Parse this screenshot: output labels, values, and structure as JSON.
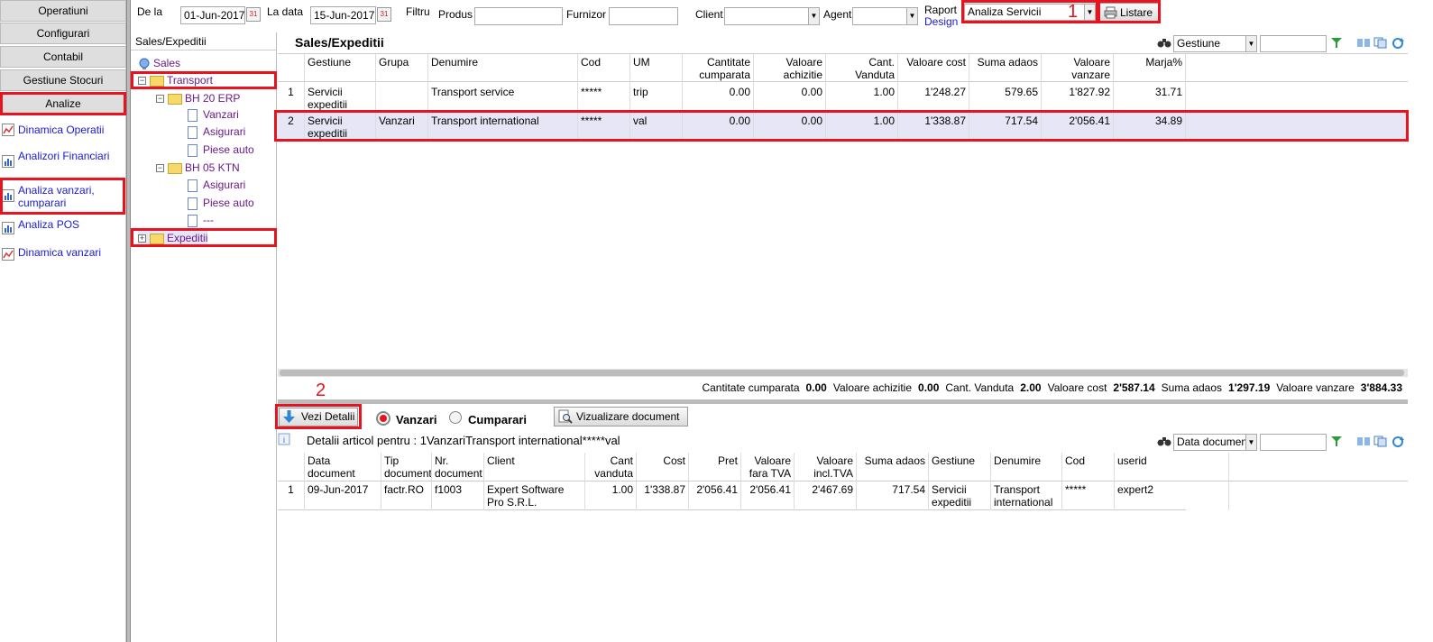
{
  "nav": {
    "buttons": [
      "Operatiuni",
      "Configurari",
      "Contabil",
      "Gestiune Stocuri",
      "Analize"
    ],
    "links": [
      "Dinamica Operatii",
      "Analizori Financiari",
      "Analiza vanzari, cumparari",
      "Analiza POS",
      "Dinamica vanzari"
    ]
  },
  "toolbar": {
    "de_la_label": "De la",
    "de_la_value": "01-Jun-2017",
    "la_data_label": "La data",
    "la_data_value": "15-Jun-2017",
    "filtru_label": "Filtru",
    "produs_label": "Produs",
    "furnizor_label": "Furnizor",
    "client_label": "Client",
    "agent_label": "Agent",
    "raport_label": "Raport",
    "design_link": "Design",
    "raport_value": "Analiza Servicii",
    "listare_label": "Listare",
    "marker1": "1",
    "marker2": "2"
  },
  "tree": {
    "header": "Sales/Expeditii",
    "items": [
      "Sales",
      "Transport",
      "BH 20 ERP",
      "Vanzari",
      "Asigurari",
      "Piese auto",
      "BH 05 KTN",
      "Asigurari",
      "Piese auto",
      "---",
      "Expeditii"
    ]
  },
  "main": {
    "title": "Sales/Expeditii",
    "gestiune_select": "Gestiune",
    "columns": [
      "Gestiune",
      "Grupa",
      "Denumire",
      "Cod",
      "UM",
      "Cantitate cumparata",
      "Valoare achizitie",
      "Cant. Vanduta",
      "Valoare cost",
      "Suma adaos",
      "Valoare vanzare",
      "Marja%"
    ],
    "rows": [
      [
        "1",
        "Servicii expeditii",
        "",
        "Transport service",
        "*****",
        "trip",
        "0.00",
        "0.00",
        "1.00",
        "1'248.27",
        "579.65",
        "1'827.92",
        "31.71"
      ],
      [
        "2",
        "Servicii expeditii",
        "Vanzari",
        "Transport international",
        "*****",
        "val",
        "0.00",
        "0.00",
        "1.00",
        "1'338.87",
        "717.54",
        "2'056.41",
        "34.89"
      ]
    ],
    "totals": [
      {
        "label": "Cantitate cumparata",
        "value": "0.00"
      },
      {
        "label": "Valoare achizitie",
        "value": "0.00"
      },
      {
        "label": "Cant. Vanduta",
        "value": "2.00"
      },
      {
        "label": "Valoare cost",
        "value": "2'587.14"
      },
      {
        "label": "Suma adaos",
        "value": "1'297.19"
      },
      {
        "label": "Valoare vanzare",
        "value": "3'884.33"
      }
    ]
  },
  "details": {
    "vezi_label": "Vezi Detalii",
    "radio_vanzari": "Vanzari",
    "radio_cumparari": "Cumparari",
    "viz_button": "Vizualizare document",
    "title": "Detalii articol pentru : 1VanzariTransport international*****val",
    "sort_select": "Data documen",
    "columns": [
      "Data document",
      "Tip document",
      "Nr. document",
      "Client",
      "Cant vanduta",
      "Cost",
      "Pret",
      "Valoare fara TVA",
      "Valoare incl.TVA",
      "Suma adaos",
      "Gestiune",
      "Denumire",
      "Cod",
      "userid"
    ],
    "rows": [
      [
        "1",
        "09-Jun-2017",
        "factr.RO",
        "f1003",
        "Expert Software Pro S.R.L.",
        "1.00",
        "1'338.87",
        "2'056.41",
        "2'056.41",
        "2'467.69",
        "717.54",
        "Servicii expeditii",
        "Transport international",
        "*****",
        "expert2"
      ]
    ]
  }
}
